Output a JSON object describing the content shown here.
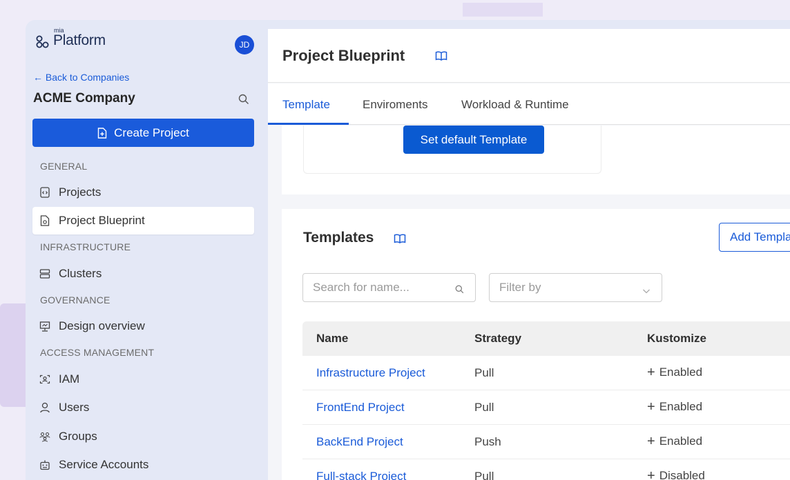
{
  "sidebar": {
    "logo": {
      "mia": "mia",
      "platform": "Platform"
    },
    "avatar_initials": "JD",
    "back_link": "← Back to Companies",
    "company": "ACME Company",
    "create_project": "Create Project",
    "sections": {
      "general": "GENERAL",
      "infrastructure": "INFRASTRUCTURE",
      "governance": "GOVERNANCE",
      "access": "ACCESS MANAGEMENT"
    },
    "items": {
      "projects": "Projects",
      "blueprint": "Project Blueprint",
      "clusters": "Clusters",
      "design": "Design overview",
      "iam": "IAM",
      "users": "Users",
      "groups": "Groups",
      "service_accounts": "Service Accounts"
    }
  },
  "header": {
    "title": "Project Blueprint",
    "tabs": [
      "Template",
      "Enviroments",
      "Workload & Runtime"
    ]
  },
  "template_card": {
    "default_button": "Set default Template"
  },
  "templates": {
    "title": "Templates",
    "add_button": "Add Template",
    "search_placeholder": "Search for name...",
    "filter_placeholder": "Filter by",
    "columns": [
      "Name",
      "Strategy",
      "Kustomize"
    ],
    "rows": [
      {
        "name": "Infrastructure Project",
        "strategy": "Pull",
        "kustomize": "Enabled"
      },
      {
        "name": "FrontEnd Project",
        "strategy": "Pull",
        "kustomize": "Enabled"
      },
      {
        "name": "BackEnd Project",
        "strategy": "Push",
        "kustomize": "Enabled"
      },
      {
        "name": "Full-stack Project",
        "strategy": "Pull",
        "kustomize": "Disabled"
      }
    ]
  },
  "colors": {
    "accent": "#1a5bd8",
    "sidebar_bg": "#e4e8f6",
    "page_bg": "#efecf8"
  }
}
